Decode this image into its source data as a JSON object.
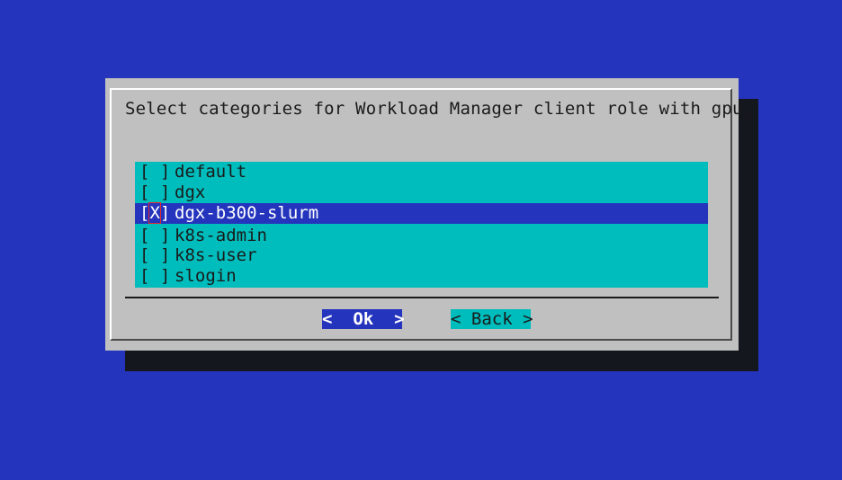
{
  "dialog": {
    "prompt": "Select categories for Workload Manager client role with gpu."
  },
  "items": [
    {
      "check_open": "[",
      "mark": " ",
      "check_close": "]",
      "label": "default",
      "selected": false
    },
    {
      "check_open": "[",
      "mark": " ",
      "check_close": "]",
      "label": "dgx",
      "selected": false
    },
    {
      "check_open": "[",
      "mark": "X",
      "check_close": "]",
      "label": "dgx-b300-slurm",
      "selected": true
    },
    {
      "check_open": "[",
      "mark": " ",
      "check_close": "]",
      "label": "k8s-admin",
      "selected": false
    },
    {
      "check_open": "[",
      "mark": " ",
      "check_close": "]",
      "label": "k8s-user",
      "selected": false
    },
    {
      "check_open": "[",
      "mark": " ",
      "check_close": "]",
      "label": "slogin",
      "selected": false
    }
  ],
  "buttons": {
    "ok_label": "<  Ok  >",
    "back_label": "< Back >"
  },
  "colors": {
    "background": "#2434bd",
    "dialog": "#c0c0c0",
    "list": "#00bdbd",
    "highlight": "#2434bd"
  }
}
